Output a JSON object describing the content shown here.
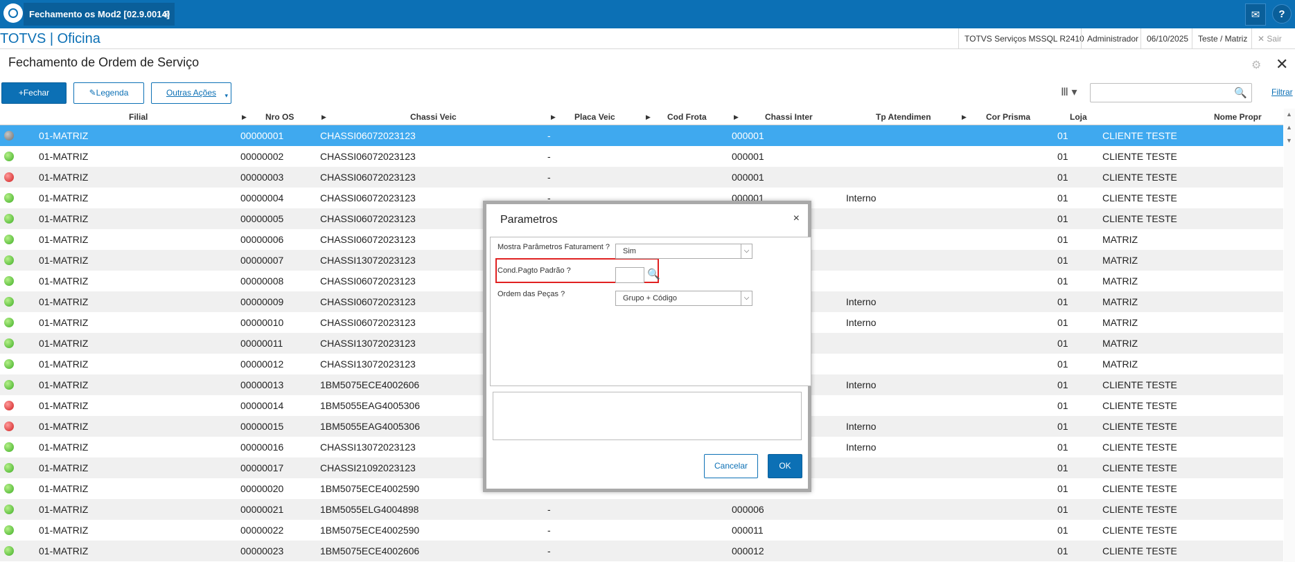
{
  "app": {
    "tab_title": "Fechamento os Mod2 [02.9.0014]",
    "tab_close": "⊗",
    "brand": "TOTVS | Oficina",
    "info": [
      "TOTVS Serviços MSSQL R2410",
      "Administrador",
      "06/10/2025",
      "Teste / Matriz"
    ],
    "exit": "✕ Sair",
    "mail_icon": "✉",
    "help_icon": "?"
  },
  "page": {
    "title": "Fechamento de Ordem de Serviço",
    "close": "✕",
    "gear": "⚙"
  },
  "toolbar": {
    "fechar": "+Fechar",
    "legenda": "✎Legenda",
    "outras": "Outras Ações",
    "outras_caret": "▾",
    "columns": "Ⅲ ▾",
    "search_icon": "🔍",
    "filtrar": "Filtrar"
  },
  "grid": {
    "headers": [
      "Filial",
      "Nro OS",
      "Chassi Veic",
      "Placa Veic",
      "Cod Frota",
      "Chassi Inter",
      "Tp Atendimen",
      "Cor Prisma",
      "Loja",
      "Nome Propr"
    ],
    "arrow": "▶",
    "rows": [
      {
        "status": "gray",
        "filial": "01-MATRIZ",
        "os": "00000001",
        "chassi": "CHASSI06072023123",
        "placa": "-",
        "inter": "000001",
        "tp": "",
        "loja": "01",
        "nome": "CLIENTE TESTE"
      },
      {
        "status": "green",
        "filial": "01-MATRIZ",
        "os": "00000002",
        "chassi": "CHASSI06072023123",
        "placa": "-",
        "inter": "000001",
        "tp": "",
        "loja": "01",
        "nome": "CLIENTE TESTE"
      },
      {
        "status": "red",
        "filial": "01-MATRIZ",
        "os": "00000003",
        "chassi": "CHASSI06072023123",
        "placa": "-",
        "inter": "000001",
        "tp": "",
        "loja": "01",
        "nome": "CLIENTE TESTE"
      },
      {
        "status": "green",
        "filial": "01-MATRIZ",
        "os": "00000004",
        "chassi": "CHASSI06072023123",
        "placa": "-",
        "inter": "000001",
        "tp": "Interno",
        "loja": "01",
        "nome": "CLIENTE TESTE"
      },
      {
        "status": "green",
        "filial": "01-MATRIZ",
        "os": "00000005",
        "chassi": "CHASSI06072023123",
        "placa": "",
        "inter": "",
        "tp": "",
        "loja": "01",
        "nome": "CLIENTE TESTE"
      },
      {
        "status": "green",
        "filial": "01-MATRIZ",
        "os": "00000006",
        "chassi": "CHASSI06072023123",
        "placa": "",
        "inter": "",
        "tp": "",
        "loja": "01",
        "nome": "MATRIZ"
      },
      {
        "status": "green",
        "filial": "01-MATRIZ",
        "os": "00000007",
        "chassi": "CHASSI13072023123",
        "placa": "",
        "inter": "",
        "tp": "",
        "loja": "01",
        "nome": "MATRIZ"
      },
      {
        "status": "green",
        "filial": "01-MATRIZ",
        "os": "00000008",
        "chassi": "CHASSI06072023123",
        "placa": "",
        "inter": "",
        "tp": "",
        "loja": "01",
        "nome": "MATRIZ"
      },
      {
        "status": "green",
        "filial": "01-MATRIZ",
        "os": "00000009",
        "chassi": "CHASSI06072023123",
        "placa": "",
        "inter": "",
        "tp": "Interno",
        "loja": "01",
        "nome": "MATRIZ"
      },
      {
        "status": "green",
        "filial": "01-MATRIZ",
        "os": "00000010",
        "chassi": "CHASSI06072023123",
        "placa": "",
        "inter": "",
        "tp": "Interno",
        "loja": "01",
        "nome": "MATRIZ"
      },
      {
        "status": "green",
        "filial": "01-MATRIZ",
        "os": "00000011",
        "chassi": "CHASSI13072023123",
        "placa": "",
        "inter": "",
        "tp": "",
        "loja": "01",
        "nome": "MATRIZ"
      },
      {
        "status": "green",
        "filial": "01-MATRIZ",
        "os": "00000012",
        "chassi": "CHASSI13072023123",
        "placa": "",
        "inter": "",
        "tp": "",
        "loja": "01",
        "nome": "MATRIZ"
      },
      {
        "status": "green",
        "filial": "01-MATRIZ",
        "os": "00000013",
        "chassi": "1BM5075ECE4002606",
        "placa": "",
        "inter": "",
        "tp": "Interno",
        "loja": "01",
        "nome": "CLIENTE TESTE"
      },
      {
        "status": "red",
        "filial": "01-MATRIZ",
        "os": "00000014",
        "chassi": "1BM5055EAG4005306",
        "placa": "",
        "inter": "",
        "tp": "",
        "loja": "01",
        "nome": "CLIENTE TESTE"
      },
      {
        "status": "red",
        "filial": "01-MATRIZ",
        "os": "00000015",
        "chassi": "1BM5055EAG4005306",
        "placa": "",
        "inter": "",
        "tp": "Interno",
        "loja": "01",
        "nome": "CLIENTE TESTE"
      },
      {
        "status": "green",
        "filial": "01-MATRIZ",
        "os": "00000016",
        "chassi": "CHASSI13072023123",
        "placa": "",
        "inter": "",
        "tp": "Interno",
        "loja": "01",
        "nome": "CLIENTE TESTE"
      },
      {
        "status": "green",
        "filial": "01-MATRIZ",
        "os": "00000017",
        "chassi": "CHASSI21092023123",
        "placa": "",
        "inter": "",
        "tp": "",
        "loja": "01",
        "nome": "CLIENTE TESTE"
      },
      {
        "status": "green",
        "filial": "01-MATRIZ",
        "os": "00000020",
        "chassi": "1BM5075ECE4002590",
        "placa": "",
        "inter": "",
        "tp": "",
        "loja": "01",
        "nome": "CLIENTE TESTE"
      },
      {
        "status": "green",
        "filial": "01-MATRIZ",
        "os": "00000021",
        "chassi": "1BM5055ELG4004898",
        "placa": "-",
        "inter": "000006",
        "tp": "",
        "loja": "01",
        "nome": "CLIENTE TESTE"
      },
      {
        "status": "green",
        "filial": "01-MATRIZ",
        "os": "00000022",
        "chassi": "1BM5075ECE4002590",
        "placa": "-",
        "inter": "000011",
        "tp": "",
        "loja": "01",
        "nome": "CLIENTE TESTE"
      },
      {
        "status": "green",
        "filial": "01-MATRIZ",
        "os": "00000023",
        "chassi": "1BM5075ECE4002606",
        "placa": "-",
        "inter": "000012",
        "tp": "",
        "loja": "01",
        "nome": "CLIENTE TESTE"
      }
    ]
  },
  "dialog": {
    "title": "Parametros",
    "close": "×",
    "params": [
      {
        "label": "Mostra Parâmetros Faturament ?",
        "value": "Sim"
      },
      {
        "label": "Cond.Pagto Padrão ?",
        "value": ""
      },
      {
        "label": "Ordem das Peças ?",
        "value": "Grupo + Código"
      }
    ],
    "chev": "⌵",
    "search_icon": "🔍",
    "cancel": "Cancelar",
    "ok": "OK"
  },
  "colors": {
    "primary": "#0c70b5",
    "selected": "#3fa9ef",
    "highlight": "#e02020"
  }
}
